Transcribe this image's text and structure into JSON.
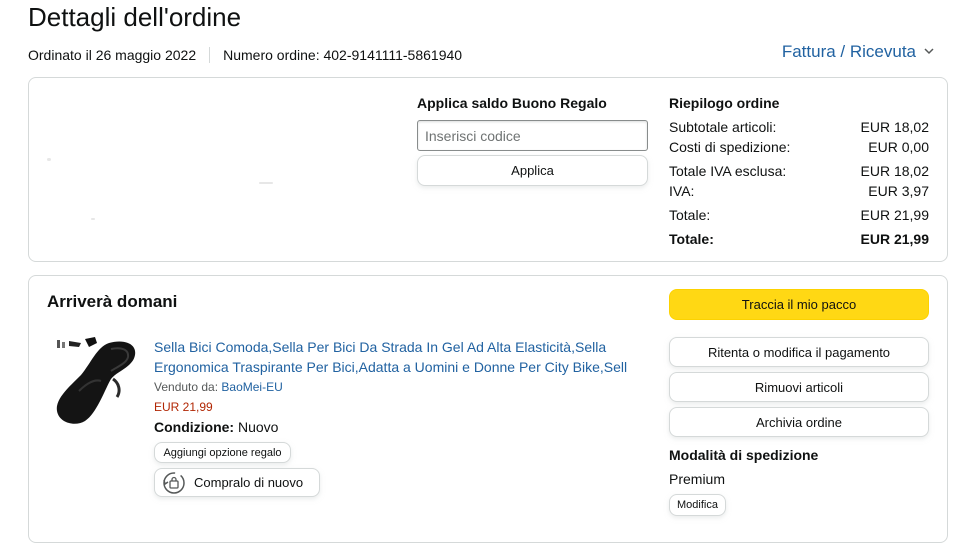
{
  "header": {
    "title": "Dettagli dell'ordine",
    "ordered_on": "Ordinato il 26 maggio 2022",
    "order_number": "Numero ordine: 402-9141111-5861940",
    "invoice_label": "Fattura / Ricevuta",
    "invoice_icon": "chevron-down-icon"
  },
  "gift_card": {
    "title": "Applica saldo Buono Regalo",
    "input_placeholder": "Inserisci codice",
    "input_value": "",
    "apply_label": "Applica"
  },
  "summary": {
    "title": "Riepilogo ordine",
    "rows": [
      {
        "label": "Subtotale articoli:",
        "value": "EUR 18,02"
      },
      {
        "label": "Costi di spedizione:",
        "value": "EUR 0,00"
      },
      {
        "label": "Totale IVA esclusa:",
        "value": "EUR 18,02"
      },
      {
        "label": "IVA:",
        "value": "EUR 3,97"
      },
      {
        "label": "Totale:",
        "value": "EUR 21,99"
      }
    ],
    "grand_total": {
      "label": "Totale:",
      "value": "EUR 21,99"
    }
  },
  "shipment": {
    "heading": "Arriverà domani",
    "product": {
      "title": "Sella Bici Comoda,Sella Per Bici Da Strada In Gel Ad Alta Elasticità,Sella Ergonomica Traspirante Per Bici,Adatta a Uomini e Donne Per City Bike,Sell",
      "sold_by_label": "Venduto da:",
      "seller": "BaoMei-EU",
      "price": "EUR 21,99",
      "condition_label": "Condizione:",
      "condition_value": "Nuovo",
      "gift_option_label": "Aggiungi opzione regalo",
      "buy_again_label": "Compralo di nuovo",
      "buy_again_icon": "buy-again-icon"
    },
    "actions": {
      "track": "Traccia il mio pacco",
      "retry_payment": "Ritenta o modifica il pagamento",
      "remove_items": "Rimuovi articoli",
      "archive": "Archivia ordine"
    },
    "shipping": {
      "title": "Modalità di spedizione",
      "mode": "Premium",
      "modify_label": "Modifica"
    }
  },
  "colors": {
    "link": "#2162a1",
    "price": "#b12704",
    "track_button": "#ffd814",
    "border": "#d5d9d9"
  }
}
